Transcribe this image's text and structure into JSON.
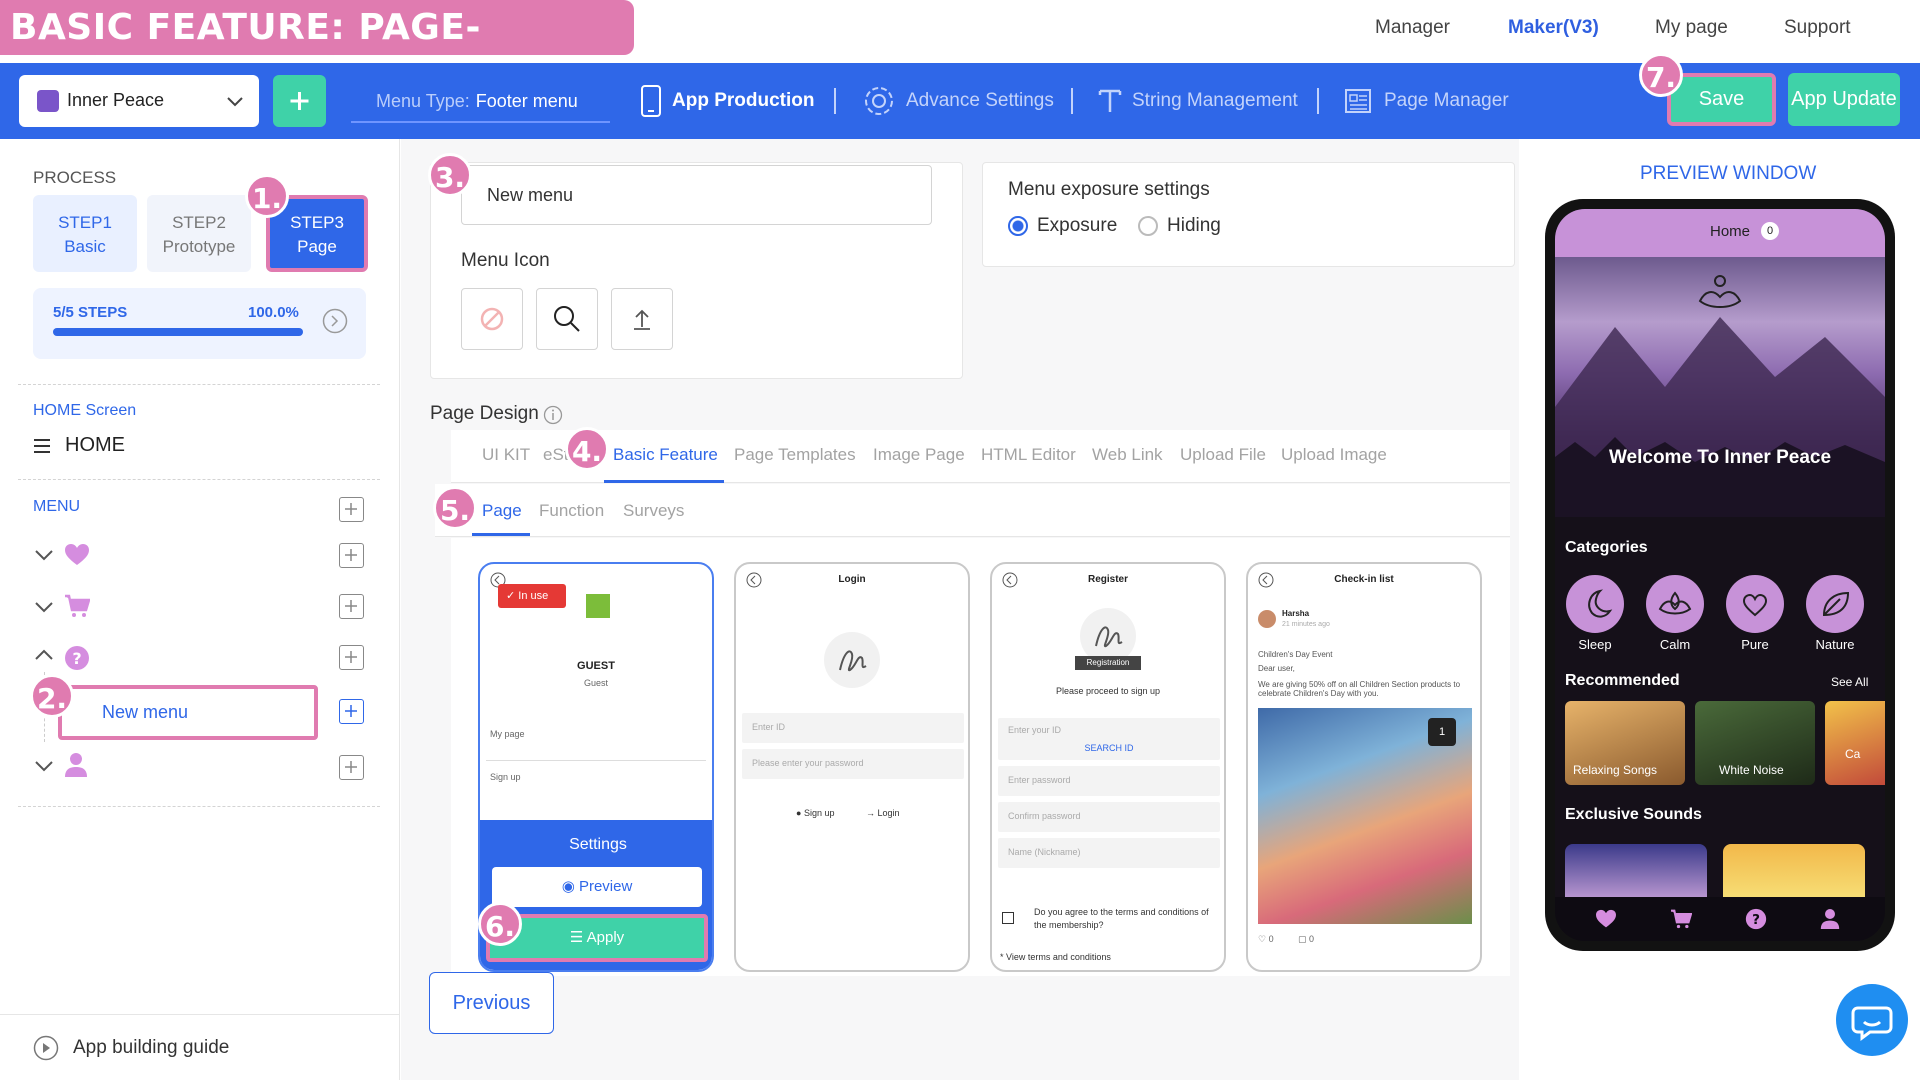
{
  "banner": {
    "title": "BASIC FEATURE: PAGE- SETTINGS"
  },
  "topnav": [
    "Manager",
    "Maker(V3)",
    "My page",
    "Support"
  ],
  "toolbar": {
    "app_name": "Inner Peace",
    "menu_type_label": "Menu Type:",
    "menu_type_value": "Footer menu",
    "items": [
      "App Production",
      "Advance Settings",
      "String Management",
      "Page Manager"
    ],
    "save": "Save",
    "app_update": "App Update"
  },
  "markers": [
    "1.",
    "2.",
    "3.",
    "4.",
    "5.",
    "6.",
    "7."
  ],
  "sidebar": {
    "process_label": "PROCESS",
    "steps": [
      {
        "line1": "STEP1",
        "line2": "Basic"
      },
      {
        "line1": "STEP2",
        "line2": "Prototype"
      },
      {
        "line1": "STEP3",
        "line2": "Page"
      }
    ],
    "progress_text": "5/5 STEPS",
    "progress_pct": "100.0%",
    "progress_value": 1.0,
    "home_section": "HOME Screen",
    "home_item": "HOME",
    "menu_section": "MENU",
    "menu_icons": [
      "heart-icon",
      "cart-icon",
      "question-icon",
      "person-icon"
    ],
    "new_menu": "New menu",
    "guide": "App building guide"
  },
  "editor": {
    "menu_name_value": "New menu",
    "menu_icon_label": "Menu Icon",
    "exposure_title": "Menu exposure settings",
    "exposure_on": "Exposure",
    "exposure_off": "Hiding",
    "page_design_label": "Page Design",
    "tabs": [
      "UI KIT",
      "eSt",
      "Basic Feature",
      "Page Templates",
      "Image Page",
      "HTML Editor",
      "Web Link",
      "Upload File",
      "Upload Image"
    ],
    "subtabs": [
      "Page",
      "Function",
      "Surveys"
    ],
    "templates": {
      "t1": {
        "badge": "In use",
        "name": "GUEST",
        "sub": "Guest",
        "row1": "My page",
        "row2": "Sign up",
        "settings": "Settings",
        "preview": "Preview",
        "apply": "Apply"
      },
      "t2": {
        "title": "Login",
        "f1": "Enter ID",
        "f2": "Please enter your password",
        "a1": "Sign up",
        "a2": "Login"
      },
      "t3": {
        "title": "Register",
        "badge": "Registration",
        "note": "Please proceed to sign up",
        "f1": "Enter your ID",
        "search": "SEARCH ID",
        "f2": "Enter password",
        "f3": "Confirm password",
        "f4": "Name (Nickname)",
        "agree": "Do you agree to the terms and conditions of the membership?",
        "terms": "* View terms and conditions"
      },
      "t4": {
        "title": "Check-in list",
        "user": "Harsha",
        "time": "21 minutes ago",
        "event": "Children's Day Event",
        "dear": "Dear user,",
        "body": "We are giving 50% off on all Children Section products to celebrate Children's Day with you.",
        "count": "1",
        "likes": "0",
        "comments": "0"
      }
    },
    "previous": "Previous"
  },
  "preview": {
    "title": "PREVIEW WINDOW",
    "home_tab": "Home",
    "home_badge": "0",
    "welcome": "Welcome To Inner Peace",
    "categories_label": "Categories",
    "categories": [
      "Sleep",
      "Calm",
      "Pure",
      "Nature"
    ],
    "recommended_label": "Recommended",
    "see_all": "See All",
    "rec_items": [
      "Relaxing Songs",
      "White Noise",
      "Ca"
    ],
    "exclusive_label": "Exclusive Sounds"
  },
  "colors": {
    "brand_blue": "#2f67e8",
    "accent_green": "#3fd2a8",
    "marker_pink": "#e07bb0"
  }
}
